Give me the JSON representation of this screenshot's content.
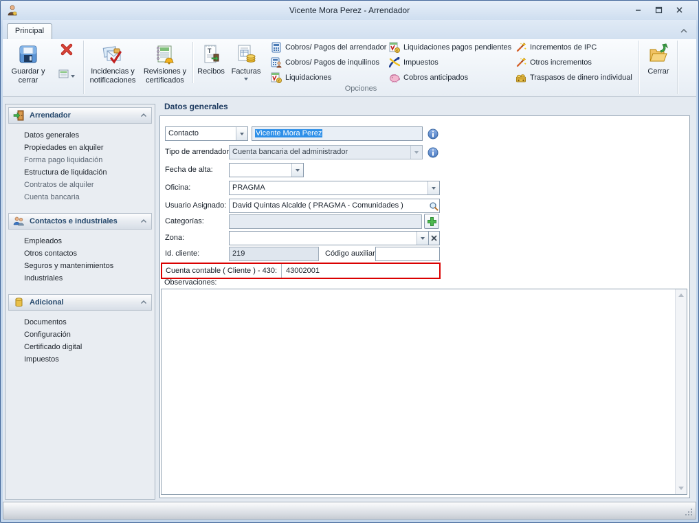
{
  "window": {
    "title": "Vicente Mora Perez - Arrendador"
  },
  "tabs": {
    "principal": "Principal"
  },
  "ribbon": {
    "save_button": "Guardar y cerrar",
    "incidencias": "Incidencias y notificaciones",
    "revisiones": "Revisiones y certificados",
    "recibos": "Recibos",
    "facturas": "Facturas",
    "links_col1": [
      "Cobros/ Pagos del arrendador",
      "Cobros/ Pagos de inquilinos",
      "Liquidaciones"
    ],
    "links_col2": [
      "Liquidaciones pagos pendientes",
      "Impuestos",
      "Cobros anticipados"
    ],
    "links_col3": [
      "Incrementos de IPC",
      "Otros incrementos",
      "Traspasos de dinero individual"
    ],
    "cerrar": "Cerrar",
    "group_label": "Opciones"
  },
  "sidebar": {
    "sections": [
      {
        "title": "Arrendador",
        "items": [
          "Datos generales",
          "Propiedades en alquiler",
          "Forma pago liquidación",
          "Estructura de liquidación",
          "Contratos de alquiler",
          "Cuenta bancaria"
        ]
      },
      {
        "title": "Contactos e industriales",
        "items": [
          "Empleados",
          "Otros contactos",
          "Seguros y mantenimientos",
          "Industriales"
        ]
      },
      {
        "title": "Adicional",
        "items": [
          "Documentos",
          "Configuración",
          "Certificado digital",
          "Impuestos"
        ]
      }
    ]
  },
  "main": {
    "title": "Datos generales",
    "form": {
      "contacto": {
        "selector_label": "Contacto",
        "value": "Vicente Mora Perez"
      },
      "tipo_arrendador": {
        "label": "Tipo de arrendador:",
        "value": "Cuenta bancaria del administrador"
      },
      "fecha_alta": {
        "label": "Fecha de alta:",
        "value": ""
      },
      "oficina": {
        "label": "Oficina:",
        "value": "PRAGMA"
      },
      "usuario_asignado": {
        "label": "Usuario Asignado:",
        "value": "David Quintas Alcalde ( PRAGMA - Comunidades )"
      },
      "categorias": {
        "label": "Categorías:",
        "value": ""
      },
      "zona": {
        "label": "Zona:",
        "value": ""
      },
      "id_cliente": {
        "label": "Id. cliente:",
        "value": "219"
      },
      "codigo_auxiliar": {
        "label": "Código auxiliar:",
        "value": ""
      },
      "cuenta_contable": {
        "label": "Cuenta contable ( Cliente ) - 430:",
        "value": "43002001"
      },
      "observaciones": {
        "label": "Observaciones:",
        "value": ""
      }
    }
  },
  "icons": {
    "app": "person",
    "save": "floppy-disk",
    "delete": "red-x",
    "record_list": "grid-with-dropdown",
    "incidencias": "envelope-check",
    "revisiones": "notepad-bell",
    "recibos": "receipt",
    "facturas": "invoice-coins",
    "cobros_arrendador": "calculator",
    "cobros_inquilinos": "calculator-person",
    "liquidaciones": "document-coin",
    "impuestos": "tax-agency-swoosh",
    "cobros_anticipados": "piggy-bank",
    "incrementos": "magic-wand",
    "traspasos": "money-chest",
    "cerrar": "open-folder-arrow",
    "arrendador_section": "door-arrow",
    "contactos_section": "two-people",
    "adicional_section": "database-cylinder",
    "info": "info-circle",
    "buscar": "magnifier",
    "agregar": "green-plus",
    "limpiar": "clear-x"
  },
  "colors": {
    "selection_bg": "#2d8fe8",
    "highlight_border": "#da0000",
    "info_icon": "#4a7ac0",
    "titlebar_bg": "#cfe0f1",
    "sidebar_bg": "#e9edf2"
  }
}
